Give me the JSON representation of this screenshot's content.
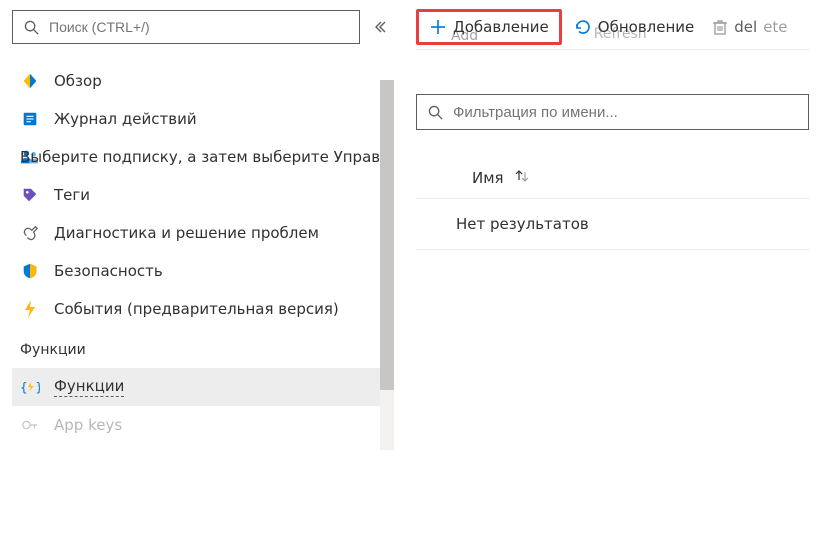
{
  "sidebar": {
    "search_placeholder": "Поиск (CTRL+/)",
    "items": [
      {
        "label": "Обзор",
        "icon": "overview"
      },
      {
        "label": "Журнал действий",
        "icon": "activity-log"
      },
      {
        "label": "Выберите подписку, а затем выберите Управление доступом (IAM).",
        "icon": "iam"
      },
      {
        "label": "Теги",
        "icon": "tags"
      },
      {
        "label": "Диагностика и решение проблем",
        "icon": "diagnose"
      },
      {
        "label": "Безопасность",
        "icon": "security"
      },
      {
        "label": "События (предварительная версия)",
        "icon": "events"
      }
    ],
    "section_label": "Функции",
    "section_items": [
      {
        "label": "Функции",
        "icon": "functions",
        "active": true
      },
      {
        "label": "App keys",
        "icon": "app-keys"
      }
    ]
  },
  "toolbar": {
    "add_label": "Добавление",
    "add_ghost": "Add",
    "refresh_label": "Обновление",
    "refresh_ghost": "Refresh",
    "delete_ghost_left": "del",
    "delete_ghost_right": "ete"
  },
  "main": {
    "filter_placeholder": "Фильтрация по имени...",
    "column_name": "Имя",
    "no_results": "Нет результатов"
  }
}
